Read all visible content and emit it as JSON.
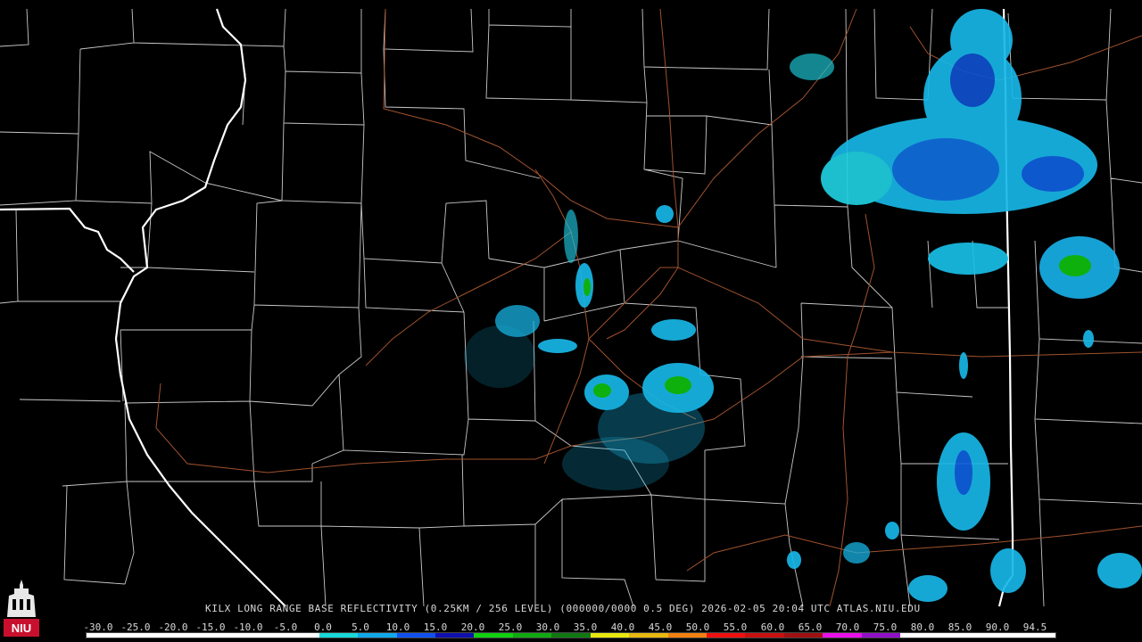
{
  "caption": "KILX LONG RANGE BASE REFLECTIVITY (0.25KM / 256 LEVEL) (000000/0000 0.5 DEG) 2026-02-05 20:04 UTC  ATLAS.NIU.EDU",
  "logo": {
    "icon": "niu-tower-icon",
    "text": "NIU",
    "color": "#c8102e"
  },
  "legend": {
    "ticks": [
      "-30.0",
      "-25.0",
      "-20.0",
      "-15.0",
      "-10.0",
      "-5.0",
      "0.0",
      "5.0",
      "10.0",
      "15.0",
      "20.0",
      "25.0",
      "30.0",
      "35.0",
      "40.0",
      "45.0",
      "50.0",
      "55.0",
      "60.0",
      "65.0",
      "70.0",
      "75.0",
      "80.0",
      "85.0",
      "90.0",
      "94.5"
    ],
    "colors": [
      "#ffffff",
      "#ffffff",
      "#ffffff",
      "#ffffff",
      "#ffffff",
      "#ffffff",
      "#18d8d8",
      "#10a8e8",
      "#1050f0",
      "#1010b0",
      "#10d010",
      "#10a810",
      "#107810",
      "#e8e810",
      "#e8b810",
      "#f08010",
      "#f01010",
      "#c81010",
      "#a01010",
      "#e810e8",
      "#9010c8",
      "#ffffff",
      "#ffffff",
      "#ffffff",
      "#ffffff"
    ]
  },
  "map_colors": {
    "background": "#000000",
    "county_lines": "#c8c8c8",
    "state_lines": "#ffffff",
    "roads": "#a0522d"
  }
}
